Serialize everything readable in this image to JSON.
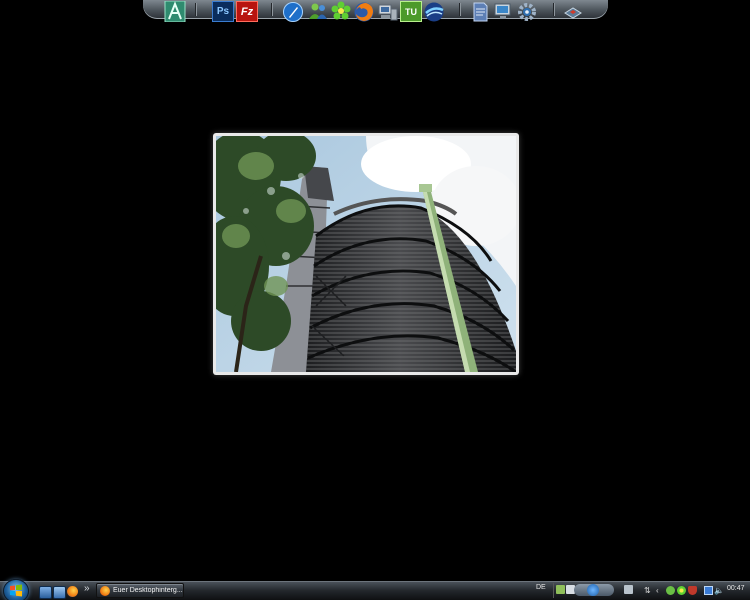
{
  "dock": {
    "items": [
      {
        "name": "font-app-icon",
        "glyph": "A"
      },
      {
        "name": "photoshop-icon",
        "label": "Ps"
      },
      {
        "name": "filezilla-icon",
        "label": "Fz"
      },
      {
        "name": "pen-tool-icon"
      },
      {
        "name": "messenger-icon"
      },
      {
        "name": "icq-flower-icon"
      },
      {
        "name": "firefox-icon"
      },
      {
        "name": "computer-icon"
      },
      {
        "name": "notepad-icon",
        "label": "TU"
      },
      {
        "name": "google-earth-icon"
      },
      {
        "name": "document-icon"
      },
      {
        "name": "monitor-icon"
      },
      {
        "name": "settings-icon"
      },
      {
        "name": "network-icon"
      }
    ]
  },
  "wallpaper": {
    "subject": "photo"
  },
  "taskbar": {
    "start_label": "Start",
    "quicklaunch_more": "»",
    "task_button_label": "Euer Desktophinterg...",
    "language": "DE",
    "clock": "00:47"
  },
  "colors": {
    "desktop_bg": "#000000",
    "taskbar_top": "#4a5159",
    "taskbar_bottom": "#0c0d0f"
  }
}
